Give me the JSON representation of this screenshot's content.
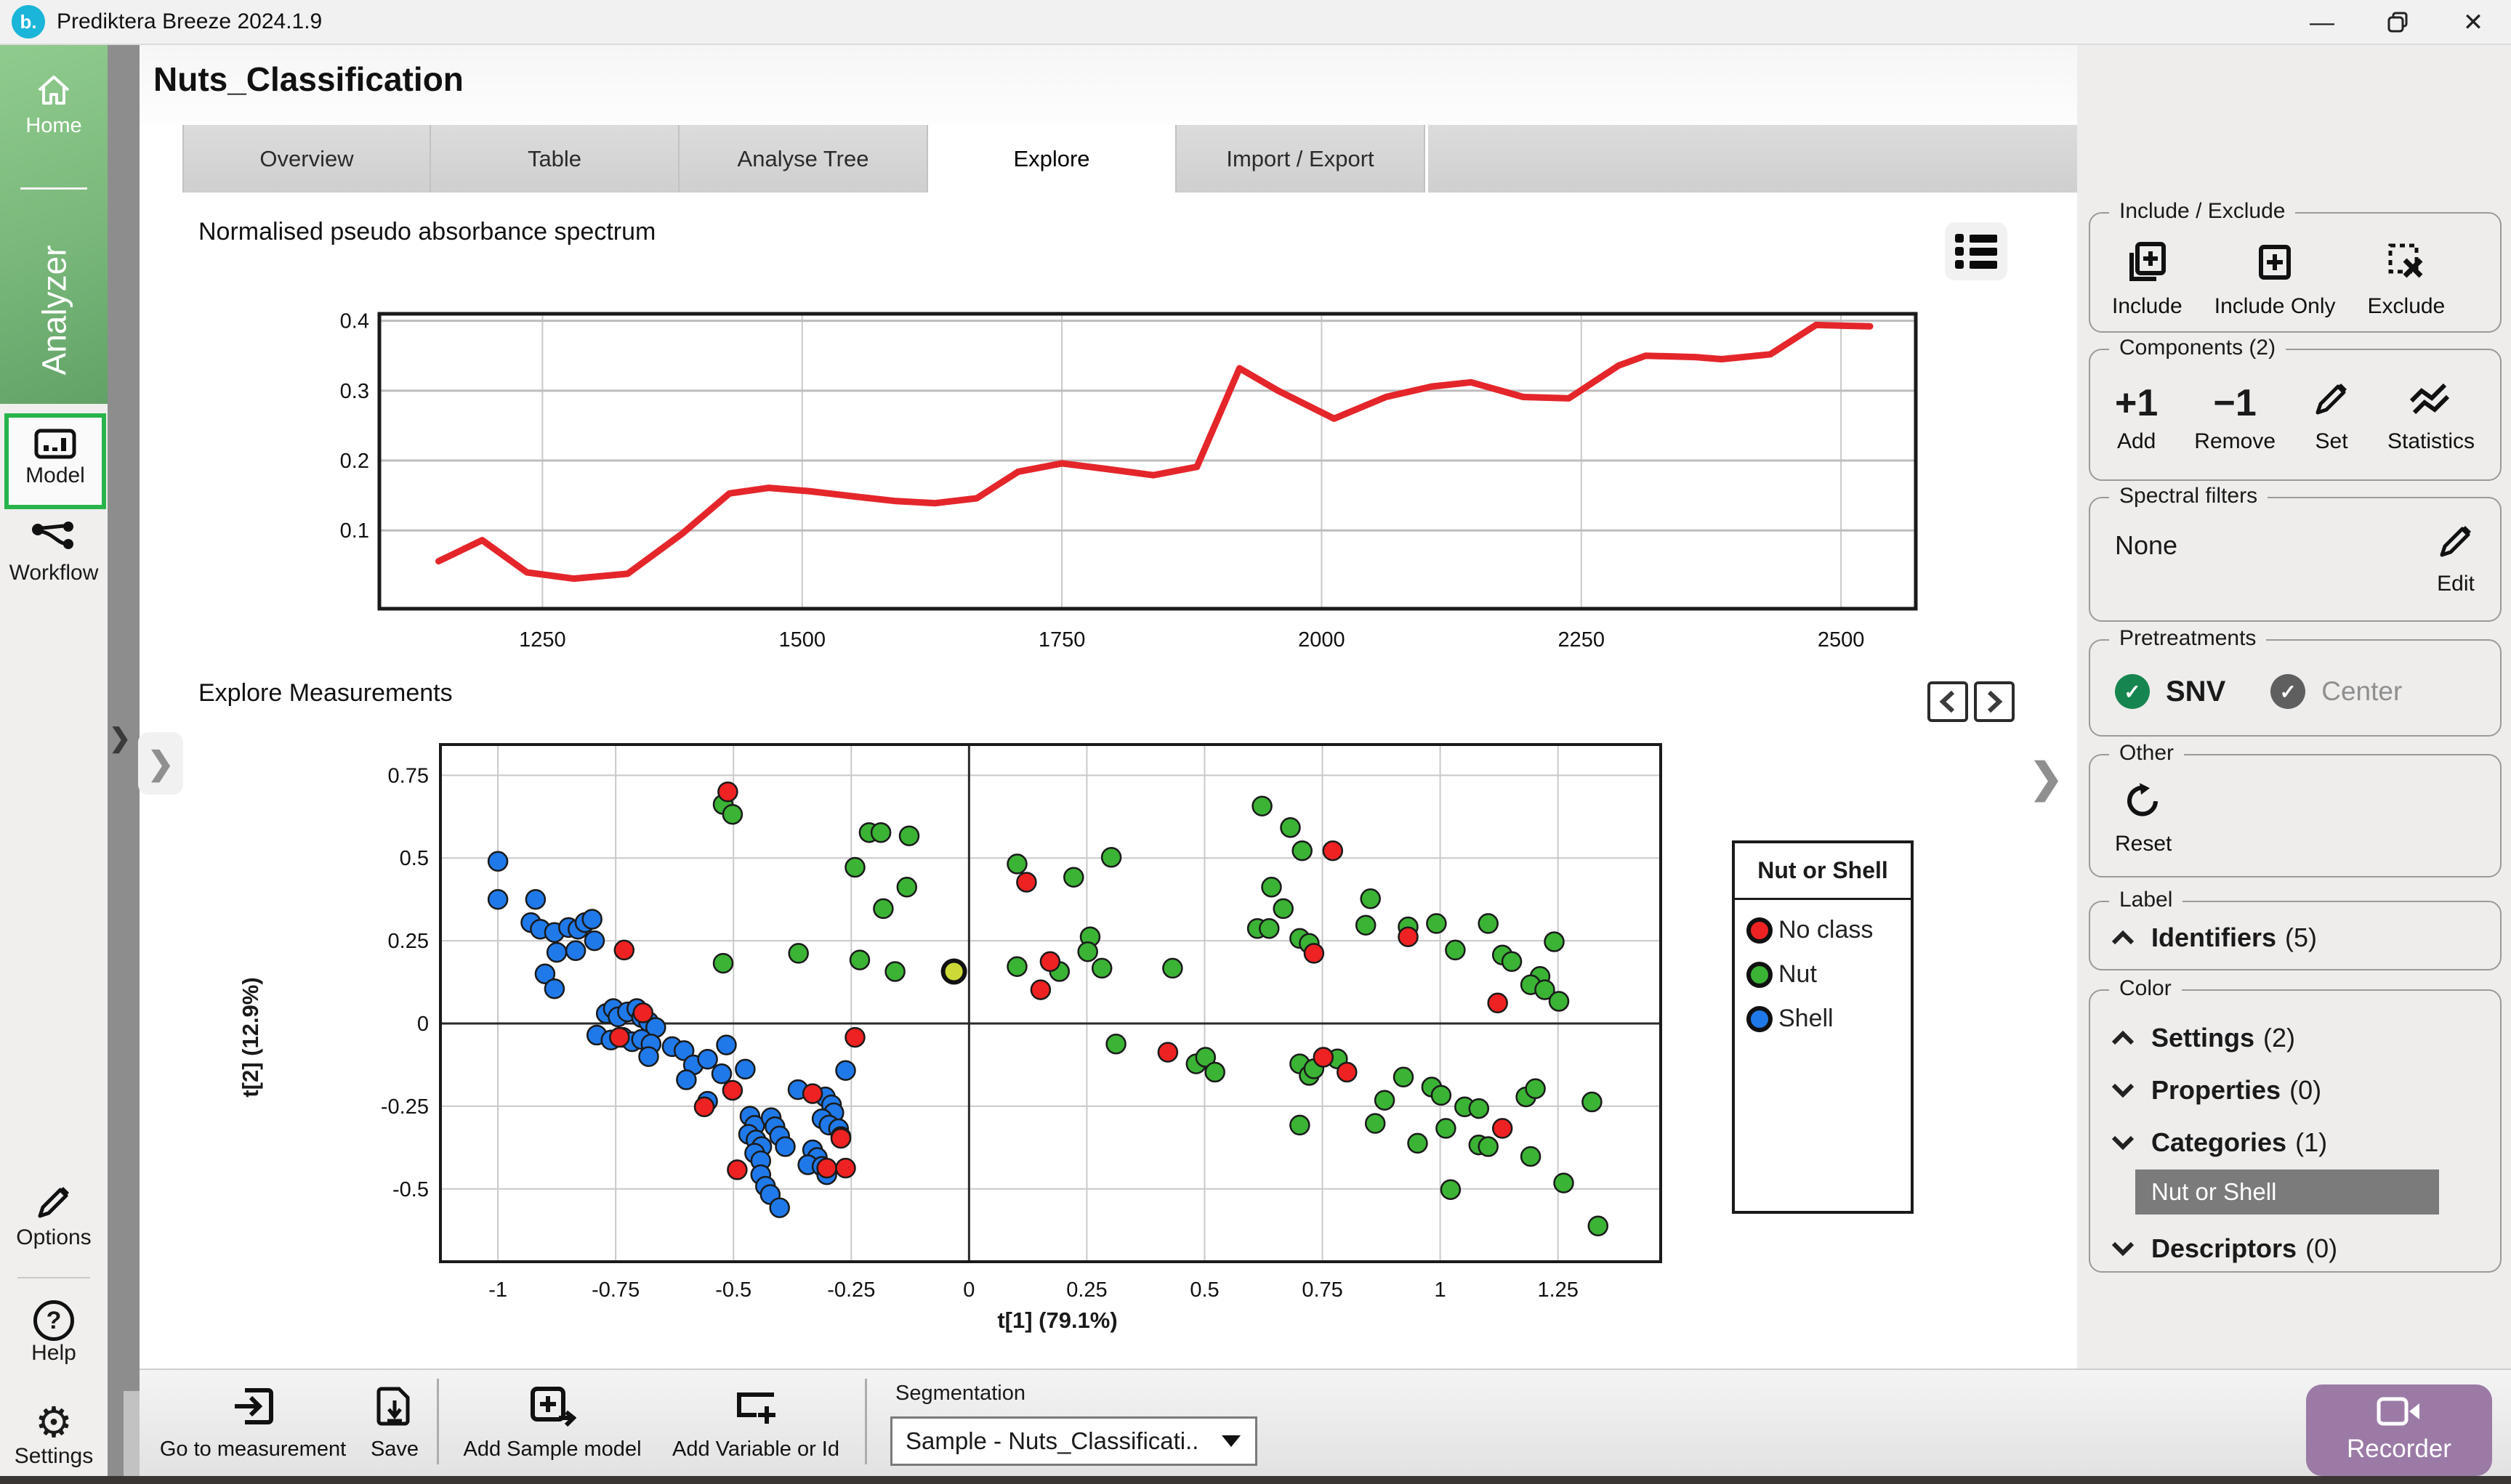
{
  "ui": {
    "titlebar": {
      "logo": "b.",
      "title": "Prediktera Breeze 2024.1.9"
    },
    "sidebar": {
      "home": "Home",
      "analyzer": "Analyzer",
      "model": "Model",
      "workflow": "Workflow",
      "options": "Options",
      "help": "Help",
      "help_glyph": "?",
      "settings": "Settings"
    },
    "page": {
      "title": "Nuts_Classification",
      "tabs": [
        "Overview",
        "Table",
        "Analyse Tree",
        "Explore",
        "Import / Export"
      ],
      "active_tab": "Explore"
    },
    "charts": {
      "spectrum_title": "Normalised pseudo absorbance spectrum",
      "explore_title": "Explore Measurements"
    },
    "legend": {
      "title": "Nut or Shell",
      "items": [
        {
          "label": "No class",
          "color": "#ee2222"
        },
        {
          "label": "Nut",
          "color": "#3bb335"
        },
        {
          "label": "Shell",
          "color": "#2079e8"
        }
      ]
    },
    "right_panel": {
      "include_section": "Include / Exclude",
      "include": "Include",
      "include_only": "Include Only",
      "exclude": "Exclude",
      "components_section": "Components (2)",
      "add_symbol": "+1",
      "add": "Add",
      "remove_symbol": "−1",
      "remove": "Remove",
      "set": "Set",
      "statistics": "Statistics",
      "spectral_section": "Spectral filters",
      "spectral_value": "None",
      "edit": "Edit",
      "pretreatments_section": "Pretreatments",
      "snv": "SNV",
      "center": "Center",
      "other_section": "Other",
      "reset": "Reset",
      "label_section": "Label",
      "identifiers": "Identifiers",
      "identifiers_count": "(5)",
      "color_section": "Color",
      "settings": "Settings",
      "settings_count": "(2)",
      "properties": "Properties",
      "properties_count": "(0)",
      "categories": "Categories",
      "categories_count": "(1)",
      "category_selected": "Nut or Shell",
      "descriptors": "Descriptors",
      "descriptors_count": "(0)"
    },
    "bottom_bar": {
      "goto": "Go to measurement",
      "save": "Save",
      "add_sample_model": "Add Sample model",
      "add_variable": "Add Variable or Id",
      "segmentation_label": "Segmentation",
      "segmentation_value": "Sample - Nuts_Classificati..",
      "recorder": "Recorder"
    },
    "colors": {
      "accent_green": "#28b44b",
      "sidebar_green": "#79b87a",
      "recorder_purple": "#9b7ba6",
      "spectrum_red": "#e4262b",
      "selected_row_gray": "#7b7b7b",
      "logo_cyan": "#1ab5d8"
    }
  },
  "chart_data": [
    {
      "type": "line",
      "title": "Normalised pseudo absorbance spectrum",
      "xlabel": "",
      "ylabel": "",
      "xlim": [
        1093,
        2572
      ],
      "ylim": [
        -0.012,
        0.41
      ],
      "xticks": [
        1250,
        1500,
        1750,
        2000,
        2250,
        2500
      ],
      "yticks": [
        0.1,
        0.2,
        0.3,
        0.4
      ],
      "grid": true,
      "series": [
        {
          "name": "spectrum",
          "color": "#e4262b",
          "points": [
            [
              1150,
              0.056
            ],
            [
              1192,
              0.086
            ],
            [
              1235,
              0.04
            ],
            [
              1280,
              0.031
            ],
            [
              1332,
              0.038
            ],
            [
              1385,
              0.096
            ],
            [
              1430,
              0.153
            ],
            [
              1468,
              0.161
            ],
            [
              1508,
              0.156
            ],
            [
              1548,
              0.149
            ],
            [
              1590,
              0.142
            ],
            [
              1628,
              0.139
            ],
            [
              1668,
              0.146
            ],
            [
              1708,
              0.184
            ],
            [
              1750,
              0.196
            ],
            [
              1793,
              0.188
            ],
            [
              1838,
              0.179
            ],
            [
              1880,
              0.191
            ],
            [
              1921,
              0.332
            ],
            [
              1958,
              0.3
            ],
            [
              2012,
              0.26
            ],
            [
              2062,
              0.291
            ],
            [
              2106,
              0.306
            ],
            [
              2144,
              0.312
            ],
            [
              2194,
              0.291
            ],
            [
              2238,
              0.289
            ],
            [
              2286,
              0.336
            ],
            [
              2312,
              0.35
            ],
            [
              2360,
              0.348
            ],
            [
              2385,
              0.345
            ],
            [
              2432,
              0.352
            ],
            [
              2476,
              0.394
            ],
            [
              2528,
              0.392
            ]
          ]
        }
      ]
    },
    {
      "type": "scatter",
      "title": "Explore Measurements",
      "xlabel": "t[1] (79.1%)",
      "ylabel": "t[2] (12.9%)",
      "xlim": [
        -1.122,
        1.468
      ],
      "ylim": [
        -0.72,
        0.843
      ],
      "xticks": [
        -1,
        -0.75,
        -0.5,
        -0.25,
        0,
        0.25,
        0.5,
        0.75,
        1,
        1.25
      ],
      "yticks": [
        -0.5,
        -0.25,
        0,
        0.25,
        0.5,
        0.75
      ],
      "grid": true,
      "legend_title": "Nut or Shell",
      "series": [
        {
          "name": "Shell",
          "color": "#2079e8",
          "points": [
            [
              -1.0,
              0.49
            ],
            [
              -1.0,
              0.375
            ],
            [
              -0.92,
              0.375
            ],
            [
              -0.93,
              0.305
            ],
            [
              -0.91,
              0.285
            ],
            [
              -0.88,
              0.275
            ],
            [
              -0.85,
              0.29
            ],
            [
              -0.83,
              0.285
            ],
            [
              -0.815,
              0.305
            ],
            [
              -0.8,
              0.315
            ],
            [
              -0.795,
              0.25
            ],
            [
              -0.835,
              0.22
            ],
            [
              -0.875,
              0.215
            ],
            [
              -0.9,
              0.15
            ],
            [
              -0.88,
              0.105
            ],
            [
              -0.77,
              0.03
            ],
            [
              -0.755,
              0.045
            ],
            [
              -0.745,
              0.02
            ],
            [
              -0.725,
              0.035
            ],
            [
              -0.705,
              0.045
            ],
            [
              -0.695,
              0.018
            ],
            [
              -0.68,
              0.005
            ],
            [
              -0.665,
              -0.012
            ],
            [
              -0.79,
              -0.035
            ],
            [
              -0.76,
              -0.05
            ],
            [
              -0.735,
              -0.042
            ],
            [
              -0.715,
              -0.055
            ],
            [
              -0.695,
              -0.048
            ],
            [
              -0.675,
              -0.062
            ],
            [
              -0.68,
              -0.1
            ],
            [
              -0.63,
              -0.07
            ],
            [
              -0.605,
              -0.082
            ],
            [
              -0.585,
              -0.125
            ],
            [
              -0.555,
              -0.108
            ],
            [
              -0.515,
              -0.065
            ],
            [
              -0.6,
              -0.17
            ],
            [
              -0.525,
              -0.152
            ],
            [
              -0.475,
              -0.138
            ],
            [
              -0.555,
              -0.235
            ],
            [
              -0.465,
              -0.28
            ],
            [
              -0.455,
              -0.308
            ],
            [
              -0.468,
              -0.335
            ],
            [
              -0.452,
              -0.352
            ],
            [
              -0.44,
              -0.372
            ],
            [
              -0.455,
              -0.392
            ],
            [
              -0.442,
              -0.415
            ],
            [
              -0.42,
              -0.285
            ],
            [
              -0.412,
              -0.312
            ],
            [
              -0.402,
              -0.34
            ],
            [
              -0.39,
              -0.372
            ],
            [
              -0.363,
              -0.2
            ],
            [
              -0.262,
              -0.142
            ],
            [
              -0.305,
              -0.222
            ],
            [
              -0.292,
              -0.246
            ],
            [
              -0.287,
              -0.27
            ],
            [
              -0.312,
              -0.288
            ],
            [
              -0.297,
              -0.307
            ],
            [
              -0.277,
              -0.318
            ],
            [
              -0.272,
              -0.342
            ],
            [
              -0.332,
              -0.382
            ],
            [
              -0.322,
              -0.405
            ],
            [
              -0.342,
              -0.427
            ],
            [
              -0.312,
              -0.432
            ],
            [
              -0.302,
              -0.457
            ],
            [
              -0.442,
              -0.457
            ],
            [
              -0.432,
              -0.492
            ],
            [
              -0.422,
              -0.517
            ],
            [
              -0.402,
              -0.557
            ]
          ]
        },
        {
          "name": "Nut",
          "color": "#3bb335",
          "points": [
            [
              -0.522,
              0.662
            ],
            [
              -0.502,
              0.632
            ],
            [
              -0.212,
              0.577
            ],
            [
              -0.187,
              0.577
            ],
            [
              -0.127,
              0.567
            ],
            [
              -0.242,
              0.472
            ],
            [
              -0.132,
              0.412
            ],
            [
              -0.182,
              0.347
            ],
            [
              -0.522,
              0.182
            ],
            [
              -0.362,
              0.212
            ],
            [
              -0.232,
              0.192
            ],
            [
              -0.157,
              0.157
            ],
            [
              0.102,
              0.482
            ],
            [
              0.222,
              0.442
            ],
            [
              0.102,
              0.172
            ],
            [
              0.192,
              0.157
            ],
            [
              0.622,
              0.657
            ],
            [
              0.682,
              0.592
            ],
            [
              0.707,
              0.522
            ],
            [
              0.302,
              0.502
            ],
            [
              0.642,
              0.412
            ],
            [
              0.667,
              0.347
            ],
            [
              0.257,
              0.262
            ],
            [
              0.612,
              0.287
            ],
            [
              0.637,
              0.287
            ],
            [
              0.702,
              0.257
            ],
            [
              0.722,
              0.242
            ],
            [
              0.852,
              0.377
            ],
            [
              0.252,
              0.217
            ],
            [
              0.282,
              0.167
            ],
            [
              0.432,
              0.167
            ],
            [
              0.842,
              0.297
            ],
            [
              0.932,
              0.292
            ],
            [
              0.992,
              0.302
            ],
            [
              1.102,
              0.302
            ],
            [
              1.032,
              0.222
            ],
            [
              1.132,
              0.207
            ],
            [
              1.152,
              0.187
            ],
            [
              1.242,
              0.247
            ],
            [
              1.212,
              0.142
            ],
            [
              1.192,
              0.117
            ],
            [
              1.222,
              0.102
            ],
            [
              1.252,
              0.067
            ],
            [
              0.312,
              -0.062
            ],
            [
              0.482,
              -0.122
            ],
            [
              0.502,
              -0.102
            ],
            [
              0.522,
              -0.147
            ],
            [
              0.702,
              -0.122
            ],
            [
              0.722,
              -0.157
            ],
            [
              0.732,
              -0.137
            ],
            [
              0.782,
              -0.107
            ],
            [
              0.922,
              -0.162
            ],
            [
              0.882,
              -0.232
            ],
            [
              0.982,
              -0.192
            ],
            [
              1.002,
              -0.217
            ],
            [
              1.052,
              -0.252
            ],
            [
              1.082,
              -0.257
            ],
            [
              1.182,
              -0.222
            ],
            [
              1.202,
              -0.197
            ],
            [
              1.322,
              -0.237
            ],
            [
              0.702,
              -0.307
            ],
            [
              0.862,
              -0.302
            ],
            [
              1.012,
              -0.317
            ],
            [
              0.952,
              -0.362
            ],
            [
              1.082,
              -0.367
            ],
            [
              1.102,
              -0.372
            ],
            [
              1.192,
              -0.402
            ],
            [
              1.022,
              -0.502
            ],
            [
              1.262,
              -0.482
            ],
            [
              1.335,
              -0.612
            ]
          ]
        },
        {
          "name": "No class",
          "color": "#ee2222",
          "points": [
            [
              -0.512,
              0.7
            ],
            [
              -0.732,
              0.222
            ],
            [
              -0.692,
              0.032
            ],
            [
              -0.742,
              -0.042
            ],
            [
              -0.502,
              -0.202
            ],
            [
              -0.562,
              -0.252
            ],
            [
              -0.332,
              -0.212
            ],
            [
              -0.242,
              -0.042
            ],
            [
              -0.272,
              -0.347
            ],
            [
              -0.302,
              -0.437
            ],
            [
              -0.262,
              -0.437
            ],
            [
              -0.492,
              -0.442
            ],
            [
              0.122,
              0.427
            ],
            [
              0.172,
              0.187
            ],
            [
              0.152,
              0.102
            ],
            [
              0.772,
              0.522
            ],
            [
              0.732,
              0.212
            ],
            [
              0.932,
              0.262
            ],
            [
              1.122,
              0.062
            ],
            [
              0.752,
              -0.102
            ],
            [
              0.802,
              -0.147
            ],
            [
              1.132,
              -0.317
            ],
            [
              0.422,
              -0.087
            ]
          ]
        }
      ],
      "selected_point": {
        "x": -0.032,
        "y": 0.157,
        "color": "#ccd937"
      }
    }
  ]
}
